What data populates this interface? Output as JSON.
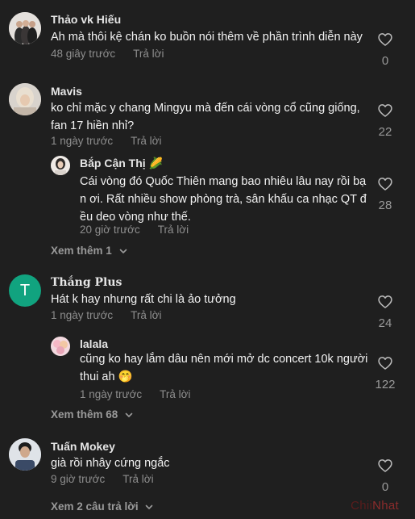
{
  "comments": [
    {
      "name": "Thảo vk Hiếu",
      "text": [
        "Ah mà thôi kệ chán ko buồn nói thêm về phần trình diễn này"
      ],
      "time": "48 giây trước",
      "reply_label": "Trả lời",
      "likes": "0"
    },
    {
      "name": "Mavis",
      "text": [
        "ko chỉ mặc y chang Mingyu mà đến cái vòng cổ cũng giống,",
        "fan 17 hiền nhỉ?"
      ],
      "time": "1 ngày trước",
      "reply_label": "Trả lời",
      "likes": "22",
      "reply": {
        "name": "Bắp Cận Thị 🌽",
        "text": [
          "Cái vòng đó Quốc Thiên mang bao nhiêu lâu nay rồi bạ",
          "n ơi. Rất nhiều show phòng trà, sân khấu ca nhạc QT đ",
          "ều deo vòng như thế."
        ],
        "time": "20 giờ trước",
        "reply_label": "Trả lời",
        "likes": "28"
      },
      "more_label": "Xem thêm 1"
    },
    {
      "name": "Thắng Plus",
      "avatar_letter": "T",
      "text": [
        "Hát k hay nhưng rất chi là ảo tưởng"
      ],
      "time": "1 ngày trước",
      "reply_label": "Trả lời",
      "likes": "24",
      "reply": {
        "name": "lalala",
        "text": [
          "cũng ko hay lắm dâu nên mới mở dc concert 10k người",
          "thui ah 🤭"
        ],
        "time": "1 ngày trước",
        "reply_label": "Trả lời",
        "likes": "122"
      },
      "more_label": "Xem thêm 68"
    },
    {
      "name": "Tuấn Mokey",
      "text": [
        "già rồi nhây cứng ngắc"
      ],
      "time": "9 giờ trước",
      "reply_label": "Trả lời",
      "likes": "0",
      "more_label": "Xem 2 câu trả lời"
    }
  ],
  "watermark": {
    "part1": "Chii",
    "part2": "Nhat"
  },
  "colors": {
    "background": "#1f1f1f",
    "muted": "#8e8e8e",
    "green_avatar": "#11a37f"
  }
}
